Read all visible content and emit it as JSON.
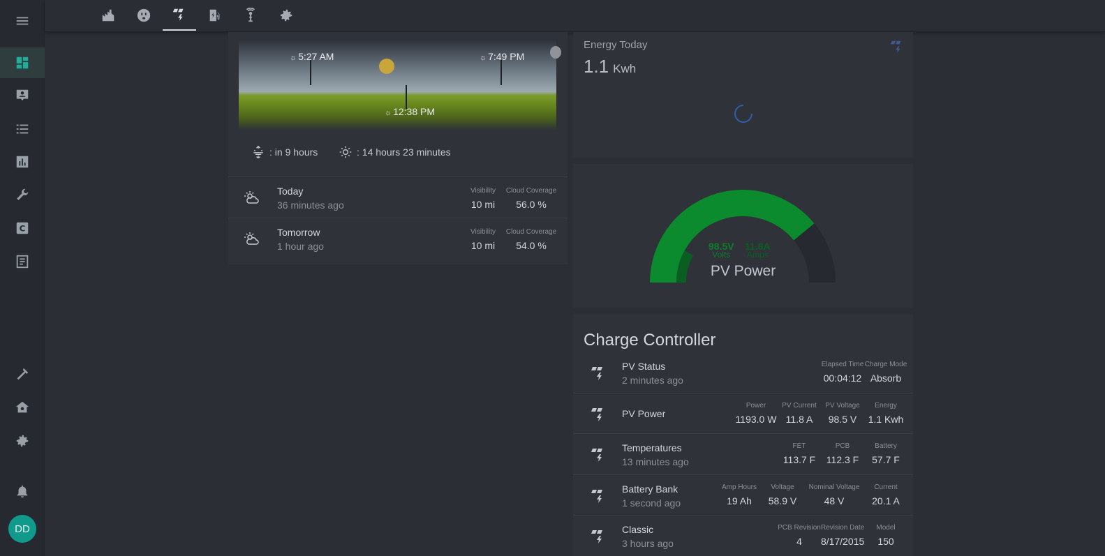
{
  "sidebar": {
    "items": [
      {
        "name": "menu-icon"
      },
      {
        "name": "dashboard-icon"
      },
      {
        "name": "contact-card-icon"
      },
      {
        "name": "list-icon"
      },
      {
        "name": "bar-chart-icon"
      },
      {
        "name": "wrench-icon"
      },
      {
        "name": "c-box-icon"
      },
      {
        "name": "document-icon"
      },
      {
        "name": "hammer-icon"
      },
      {
        "name": "home-gear-icon"
      },
      {
        "name": "settings-icon"
      },
      {
        "name": "bell-icon"
      }
    ],
    "avatar": "DD"
  },
  "topbar": {
    "icons": [
      "solar-plant-icon",
      "outlet-icon",
      "solar-power-icon",
      "ev-charger-icon",
      "antenna-icon",
      "settings-icon"
    ],
    "active_index": 2
  },
  "sun": {
    "sunrise": "5:27 AM",
    "sunset": "7:49 PM",
    "noon": "12:38 PM",
    "sunset_in": ": in 9 hours",
    "day_length": ": 14 hours 23 minutes"
  },
  "forecast": [
    {
      "title": "Today",
      "sub": "36 minutes ago",
      "visibility_label": "Visibility",
      "visibility": "10 mi",
      "cloud_label": "Cloud Coverage",
      "cloud": "56.0 %"
    },
    {
      "title": "Tomorrow",
      "sub": "1 hour ago",
      "visibility_label": "Visibility",
      "visibility": "10 mi",
      "cloud_label": "Cloud Coverage",
      "cloud": "54.0 %"
    }
  ],
  "energy": {
    "title": "Energy Today",
    "value": "1.1",
    "unit": "Kwh"
  },
  "gauge": {
    "label": "PV Power",
    "volts_value": "98.5V",
    "volts_unit": "Volts",
    "amps_value": "11.8A",
    "amps_unit": "Amps",
    "fill_fraction": 0.78
  },
  "charge_controller": {
    "title": "Charge Controller",
    "rows": [
      {
        "title": "PV Status",
        "sub": "2 minutes ago",
        "metrics": [
          {
            "label": "Elapsed Time",
            "value": "00:04:12"
          },
          {
            "label": "Charge Mode",
            "value": "Absorb"
          }
        ]
      },
      {
        "title": "PV Power",
        "sub": "",
        "metrics": [
          {
            "label": "Power",
            "value": "1193.0 W"
          },
          {
            "label": "PV Current",
            "value": "11.8 A"
          },
          {
            "label": "PV Voltage",
            "value": "98.5 V"
          },
          {
            "label": "Energy",
            "value": "1.1 Kwh"
          }
        ]
      },
      {
        "title": "Temperatures",
        "sub": "13 minutes ago",
        "metrics": [
          {
            "label": "FET",
            "value": "113.7 F"
          },
          {
            "label": "PCB",
            "value": "112.3 F"
          },
          {
            "label": "Battery",
            "value": "57.7 F"
          }
        ]
      },
      {
        "title": "Battery Bank",
        "sub": "1 second ago",
        "metrics": [
          {
            "label": "Amp Hours",
            "value": "19 Ah"
          },
          {
            "label": "Voltage",
            "value": "58.9 V"
          },
          {
            "label": "Nominal Voltage",
            "value": "48 V"
          },
          {
            "label": "Current",
            "value": "20.1 A"
          }
        ]
      },
      {
        "title": "Classic",
        "sub": "3 hours ago",
        "metrics": [
          {
            "label": "PCB Revision",
            "value": "4"
          },
          {
            "label": "Revision Date",
            "value": "8/17/2015"
          },
          {
            "label": "Model",
            "value": "150"
          }
        ]
      }
    ]
  }
}
